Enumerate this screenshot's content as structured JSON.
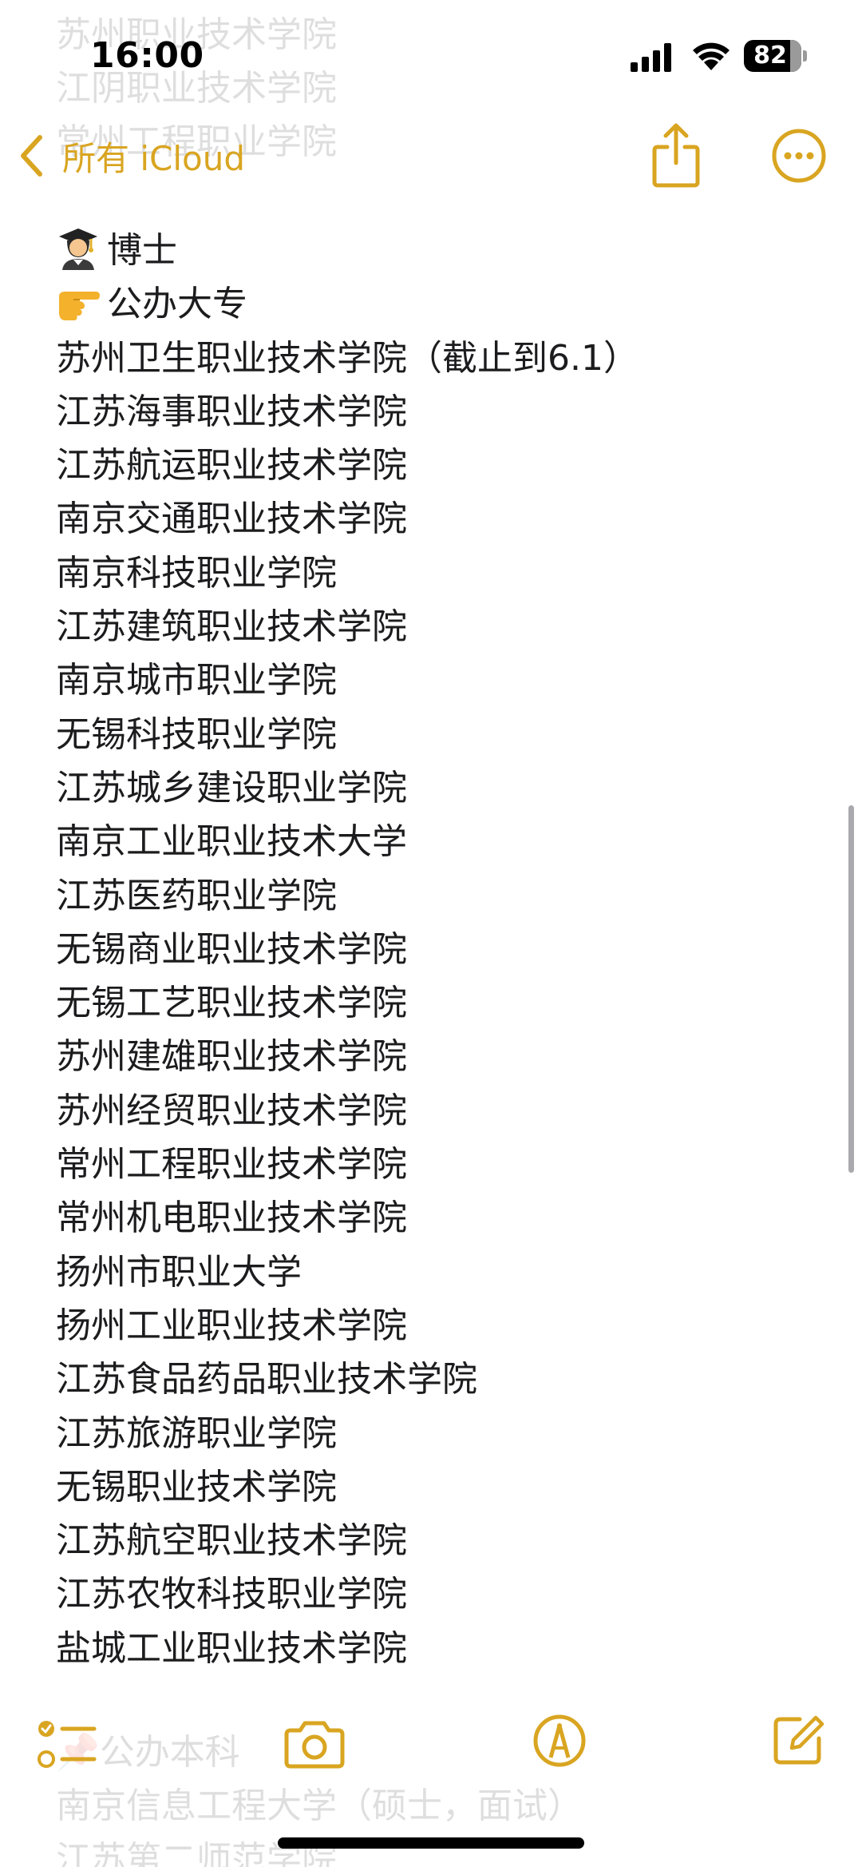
{
  "status_bar": {
    "time": "16:00",
    "battery": "82"
  },
  "nav": {
    "back_label": "所有 iCloud"
  },
  "ghost_top": [
    "苏州职业技术学院",
    "江阴职业技术学院",
    "常州工程职业学院"
  ],
  "ghost_bottom": [
    "📌公办本科",
    "南京信息工程大学（硕士，面试）",
    "江苏第二师范学院"
  ],
  "note": {
    "header_doctor": "博士",
    "header_public": "公办大专",
    "schools": [
      "苏州卫生职业技术学院（截止到6.1）",
      "江苏海事职业技术学院",
      "江苏航运职业技术学院",
      "南京交通职业技术学院",
      "南京科技职业学院",
      "江苏建筑职业技术学院",
      "南京城市职业学院",
      "无锡科技职业学院",
      "江苏城乡建设职业学院",
      "南京工业职业技术大学",
      "江苏医药职业学院",
      "无锡商业职业技术学院",
      "无锡工艺职业技术学院",
      "苏州建雄职业技术学院",
      "苏州经贸职业技术学院",
      "常州工程职业技术学院",
      "常州机电职业技术学院",
      "扬州市职业大学",
      "扬州工业职业技术学院",
      "江苏食品药品职业技术学院",
      "江苏旅游职业学院",
      "无锡职业技术学院",
      "江苏航空职业技术学院",
      "江苏农牧科技职业学院",
      "盐城工业职业技术学院"
    ]
  },
  "colors": {
    "accent": "#d9a521",
    "text": "#1c1c1e"
  },
  "icons": {
    "back": "chevron-left-icon",
    "share": "share-icon",
    "more": "ellipsis-circle-icon",
    "checklist": "checklist-icon",
    "camera": "camera-icon",
    "markup": "markup-pen-icon",
    "compose": "compose-icon"
  }
}
